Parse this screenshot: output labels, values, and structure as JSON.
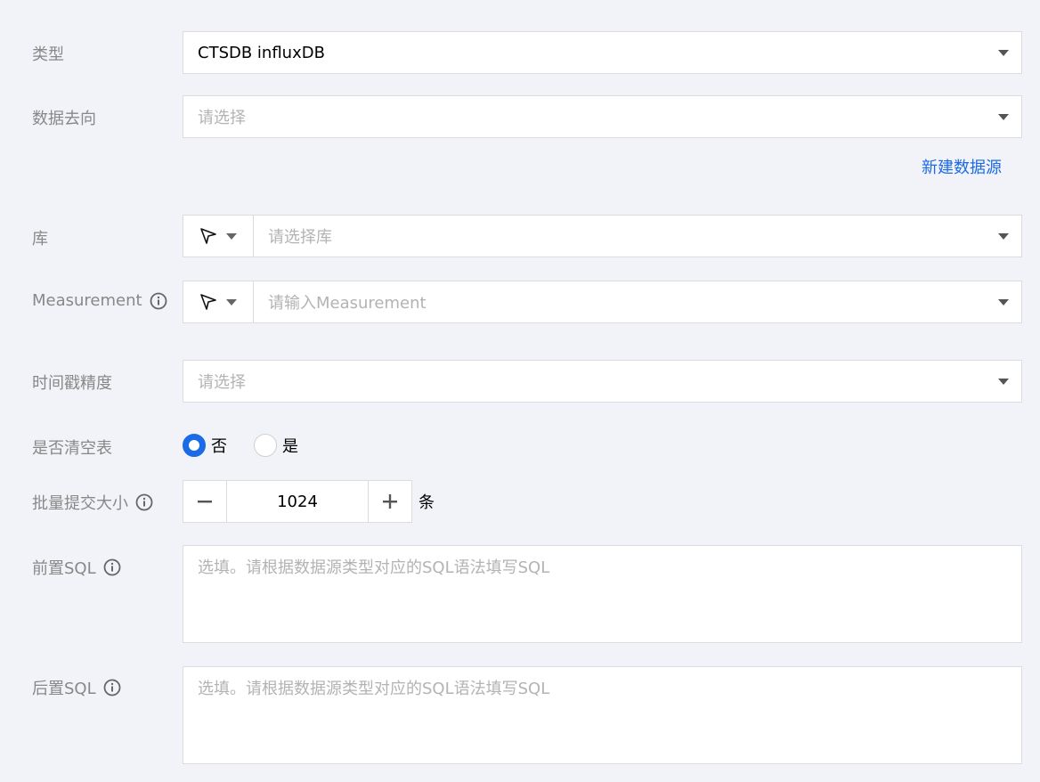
{
  "form": {
    "type": {
      "label": "类型",
      "value": "CTSDB influxDB"
    },
    "destination": {
      "label": "数据去向",
      "placeholder": "请选择",
      "new_link": "新建数据源"
    },
    "database": {
      "label": "库",
      "placeholder": "请选择库"
    },
    "measurement": {
      "label": "Measurement",
      "placeholder": "请输入Measurement"
    },
    "timestamp_precision": {
      "label": "时间戳精度",
      "placeholder": "请选择"
    },
    "clear_table": {
      "label": "是否清空表",
      "options": [
        {
          "label": "否",
          "checked": true
        },
        {
          "label": "是",
          "checked": false
        }
      ]
    },
    "batch_size": {
      "label": "批量提交大小",
      "value": "1024",
      "unit": "条"
    },
    "pre_sql": {
      "label": "前置SQL",
      "placeholder": "选填。请根据数据源类型对应的SQL语法填写SQL"
    },
    "post_sql": {
      "label": "后置SQL",
      "placeholder": "选填。请根据数据源类型对应的SQL语法填写SQL"
    }
  },
  "icons": [
    "info-icon",
    "cursor-pointer-icon",
    "chevron-down-icon",
    "minus-icon",
    "plus-icon"
  ],
  "colors": {
    "accent": "#1b6ae6",
    "background": "#f2f3f8",
    "border": "#dcdcdc",
    "label": "#888888",
    "placeholder": "#b3b3b3"
  }
}
